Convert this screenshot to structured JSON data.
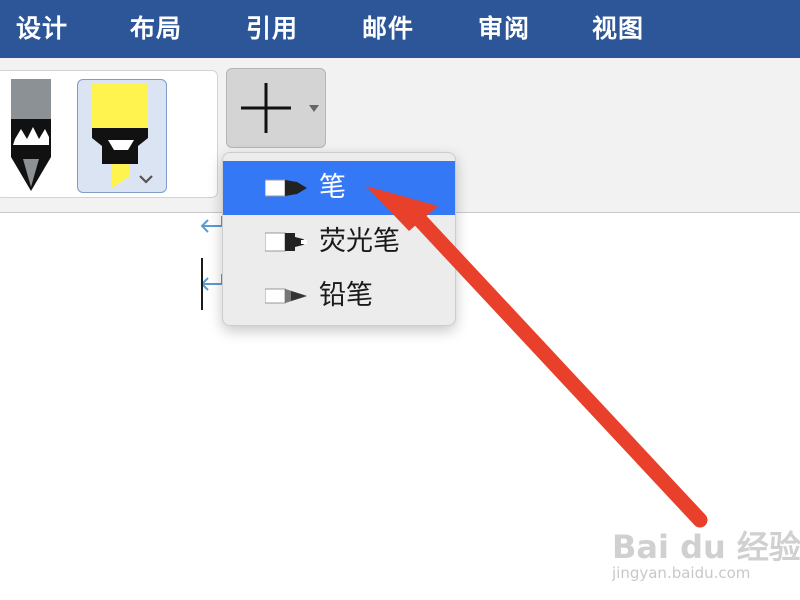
{
  "menu": {
    "tabs": [
      {
        "label": "设计"
      },
      {
        "label": "布局"
      },
      {
        "label": "引用"
      },
      {
        "label": "邮件"
      },
      {
        "label": "审阅"
      },
      {
        "label": "视图"
      }
    ]
  },
  "ribbon": {
    "pens": [
      {
        "icon": "gray-pen-icon"
      },
      {
        "icon": "yellow-highlighter-icon",
        "selected": true
      }
    ],
    "add_button": {
      "icon": "plus-icon",
      "has_dropdown": true
    }
  },
  "dropdown": {
    "items": [
      {
        "label": "笔",
        "icon": "pen-icon",
        "selected": true
      },
      {
        "label": "荧光笔",
        "icon": "highlighter-icon",
        "selected": false
      },
      {
        "label": "铅笔",
        "icon": "pencil-icon",
        "selected": false
      }
    ]
  },
  "annotation": {
    "color": "#e8402a",
    "icon": "red-arrow-icon"
  },
  "watermark": {
    "brand": "Bai du 经验",
    "url": "jingyan.baidu.com"
  },
  "colors": {
    "menubar": "#2d5699",
    "selected_item": "#3478f6",
    "highlighter": "#fff44f",
    "paragraph_mark": "#5b9bd5"
  }
}
